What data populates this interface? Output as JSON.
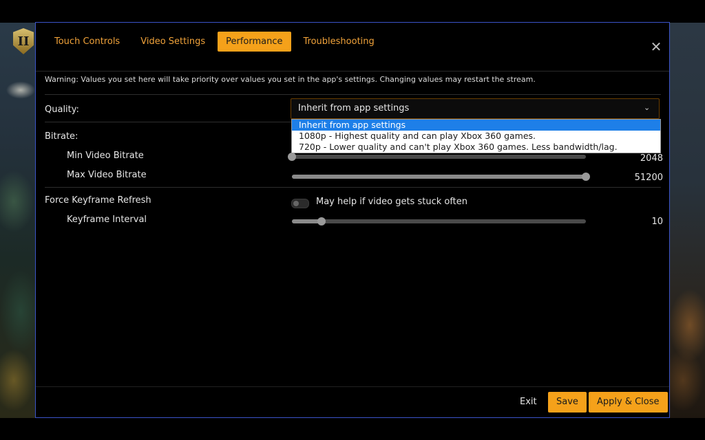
{
  "tabs": [
    {
      "label": "Touch Controls"
    },
    {
      "label": "Video Settings"
    },
    {
      "label": "Performance"
    },
    {
      "label": "Troubleshooting"
    }
  ],
  "active_tab": "Performance",
  "close_icon": "close-icon",
  "warning": "Warning: Values you set here will take priority over values you set in the app's settings. Changing values may restart the stream.",
  "quality": {
    "label": "Quality:",
    "selected": "Inherit from app settings",
    "options": [
      "Inherit from app settings",
      "1080p - Highest quality and can play Xbox 360 games.",
      "720p - Lower quality and can't play Xbox 360 games. Less bandwidth/lag."
    ]
  },
  "bitrate": {
    "label": "Bitrate:",
    "min": {
      "label": "Min Video Bitrate",
      "value": "2048",
      "fraction": 0.0
    },
    "max": {
      "label": "Max Video Bitrate",
      "value": "51200",
      "fraction": 1.0
    }
  },
  "keyframe": {
    "refresh_label": "Force Keyframe Refresh",
    "toggle_on": false,
    "toggle_hint": "May help if video gets stuck often",
    "interval_label": "Keyframe Interval",
    "interval_value": "10",
    "interval_fraction": 0.1
  },
  "footer": {
    "exit": "Exit",
    "save": "Save",
    "apply_close": "Apply & Close"
  },
  "colors": {
    "accent": "#f5a11a",
    "dialog_border": "#3b54c9",
    "dropdown_highlight": "#1e7fe8"
  }
}
